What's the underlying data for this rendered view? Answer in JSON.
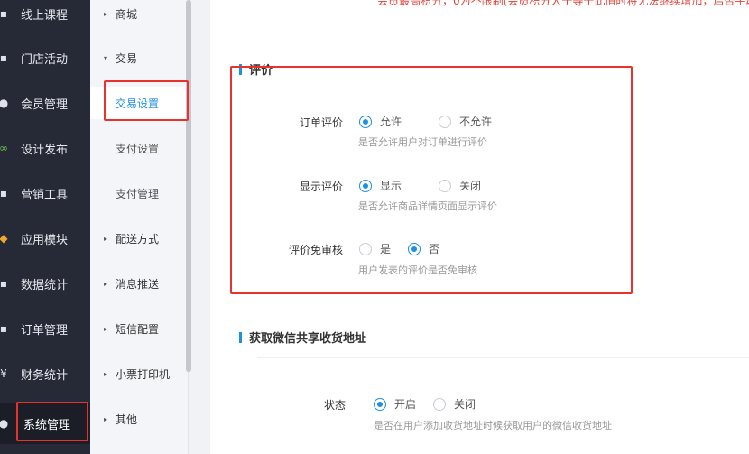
{
  "sidebar": {
    "items": [
      {
        "label": "线上课程",
        "icon": "course-icon",
        "glyph": "▪"
      },
      {
        "label": "门店活动",
        "icon": "store-icon",
        "glyph": "▪"
      },
      {
        "label": "会员管理",
        "icon": "user-icon",
        "glyph": "●"
      },
      {
        "label": "设计发布",
        "icon": "link-icon",
        "glyph": "∞"
      },
      {
        "label": "营销工具",
        "icon": "tool-icon",
        "glyph": "▪"
      },
      {
        "label": "应用模块",
        "icon": "app-icon",
        "glyph": "◆"
      },
      {
        "label": "数据统计",
        "icon": "chart-icon",
        "glyph": "▪"
      },
      {
        "label": "订单管理",
        "icon": "order-icon",
        "glyph": "▪"
      },
      {
        "label": "财务统计",
        "icon": "finance-icon",
        "glyph": "¥"
      },
      {
        "label": "系统管理",
        "icon": "system-icon",
        "glyph": "●"
      }
    ]
  },
  "submenu": {
    "items": [
      {
        "label": "商城",
        "arrow": "▸"
      },
      {
        "label": "交易",
        "arrow": "▾"
      },
      {
        "label": "交易设置",
        "arrow": ""
      },
      {
        "label": "支付设置",
        "arrow": ""
      },
      {
        "label": "支付管理",
        "arrow": ""
      },
      {
        "label": "配送方式",
        "arrow": "▸"
      },
      {
        "label": "消息推送",
        "arrow": "▸"
      },
      {
        "label": "短信配置",
        "arrow": "▸"
      },
      {
        "label": "小票打印机",
        "arrow": "▸"
      },
      {
        "label": "其他",
        "arrow": "▸"
      }
    ]
  },
  "main": {
    "top_note": "会员最高积分，0为不限制(会员积分大于等于此值时将无法继续增加，启否手动充",
    "review_section": {
      "title": "评价",
      "rows": [
        {
          "label": "订单评价",
          "options": [
            "允许",
            "不允许"
          ],
          "selected": "允许",
          "hint": "是否允许用户对订单进行评价"
        },
        {
          "label": "显示评价",
          "options": [
            "显示",
            "关闭"
          ],
          "selected": "显示",
          "hint": "是否允许商品详情页面显示评价"
        },
        {
          "label": "评价免审核",
          "options": [
            "是",
            "否"
          ],
          "selected": "否",
          "hint": "用户发表的评价是否免审核"
        }
      ]
    },
    "address_section": {
      "title": "获取微信共享收货地址",
      "rows": [
        {
          "label": "状态",
          "options": [
            "开启",
            "关闭"
          ],
          "selected": "开启",
          "hint": "是否在用户添加收货地址时候获取用户的微信收货地址"
        }
      ]
    }
  },
  "colors": {
    "accent": "#1f8fe0",
    "annotation": "#e8322d",
    "sidebar": "#262a36"
  }
}
